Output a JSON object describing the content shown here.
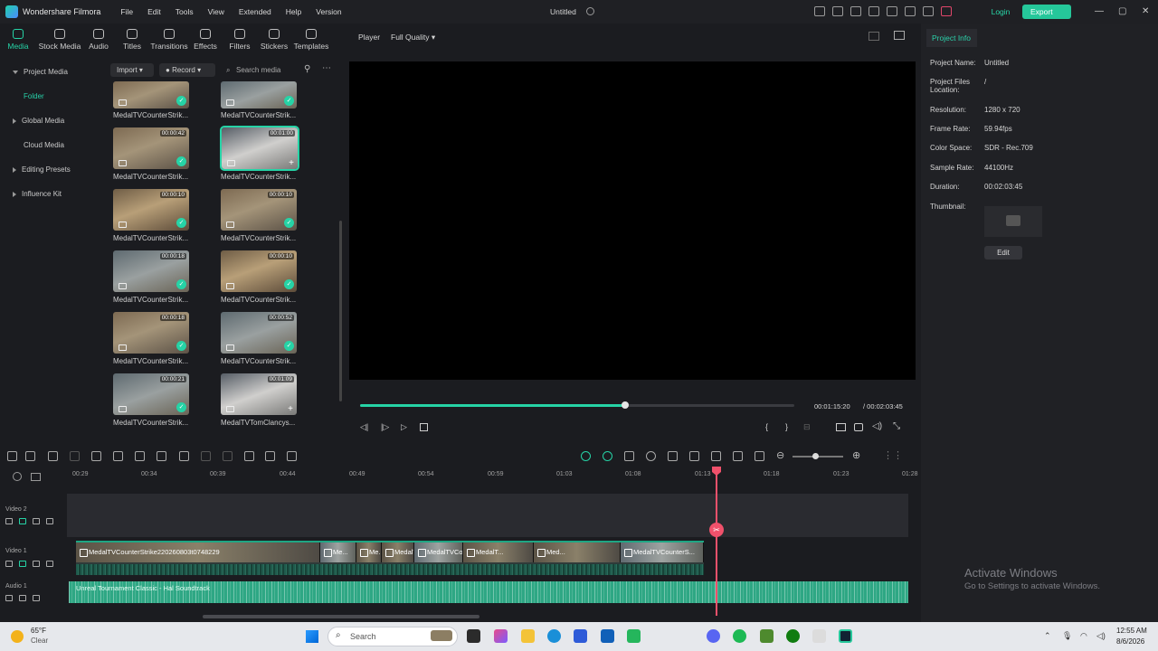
{
  "app": {
    "name": "Wondershare Filmora",
    "menu": [
      "File",
      "Edit",
      "Tools",
      "View",
      "Extended",
      "Help",
      "Version"
    ],
    "project_title": "Untitled",
    "login": "Login",
    "export": "Export"
  },
  "toolbar": [
    "Media",
    "Stock Media",
    "Audio",
    "Titles",
    "Transitions",
    "Effects",
    "Filters",
    "Stickers",
    "Templates"
  ],
  "sidebar": [
    {
      "label": "Project Media"
    },
    {
      "label": "Folder"
    },
    {
      "label": "Global Media"
    },
    {
      "label": "Cloud Media"
    },
    {
      "label": "Editing Presets"
    },
    {
      "label": "Influence Kit"
    }
  ],
  "media_tools": {
    "import": "Import",
    "record": "Record",
    "search_placeholder": "Search media"
  },
  "media": [
    {
      "caption": "MedalTVCounterStrik...",
      "duration": ""
    },
    {
      "caption": "MedalTVCounterStrik...",
      "duration": ""
    },
    {
      "caption": "MedalTVCounterStrik...",
      "duration": "00:00:42"
    },
    {
      "caption": "MedalTVCounterStrik...",
      "duration": "00:01:00"
    },
    {
      "caption": "MedalTVCounterStrik...",
      "duration": "00:00:10"
    },
    {
      "caption": "MedalTVCounterStrik...",
      "duration": "00:00:10"
    },
    {
      "caption": "MedalTVCounterStrik...",
      "duration": "00:00:18"
    },
    {
      "caption": "MedalTVCounterStrik...",
      "duration": "00:00:10"
    },
    {
      "caption": "MedalTVCounterStrik...",
      "duration": "00:00:18"
    },
    {
      "caption": "MedalTVCounterStrik...",
      "duration": "00:00:52"
    },
    {
      "caption": "MedalTVCounterStrik...",
      "duration": "00:00:21"
    },
    {
      "caption": "MedalTVTomClancys...",
      "duration": "00:01:09"
    }
  ],
  "player": {
    "label": "Player",
    "quality": "Full Quality",
    "current_time": "00:01:15:20",
    "total_time": "/ 00:02:03:45",
    "progress": 0.61
  },
  "info": {
    "tab": "Project Info",
    "rows": [
      {
        "label": "Project Name:",
        "value": "Untitled"
      },
      {
        "label": "Project Files Location:",
        "value": "/"
      },
      {
        "label": "Resolution:",
        "value": "1280 x 720"
      },
      {
        "label": "Frame Rate:",
        "value": "59.94fps"
      },
      {
        "label": "Color Space:",
        "value": "SDR - Rec.709"
      },
      {
        "label": "Sample Rate:",
        "value": "44100Hz"
      },
      {
        "label": "Duration:",
        "value": "00:02:03:45"
      },
      {
        "label": "Thumbnail:",
        "value": ""
      }
    ],
    "edit": "Edit"
  },
  "watermark": {
    "title": "Activate Windows",
    "sub": "Go to Settings to activate Windows."
  },
  "ruler": [
    "00:29",
    "00:34",
    "00:39",
    "00:44",
    "00:49",
    "00:54",
    "00:59",
    "01:03",
    "01:08",
    "01:13",
    "01:18",
    "01:23",
    "01:28"
  ],
  "tracks": {
    "video2": "Video 2",
    "video1": "Video 1",
    "audio1": "Audio 1",
    "clips": [
      "MedalTVCounterStrike220260803t0748229",
      "Me...",
      "Me...",
      "MedalT...",
      "MedalTVCoun...",
      "MedalT...",
      "Med...",
      "MedalTVCounterS..."
    ],
    "audio_name": "Unreal Tournament Classic - Hal Soundtrack"
  },
  "taskbar": {
    "temp": "65°F",
    "weather": "Clear",
    "search": "Search",
    "time": "12:55 AM",
    "date": "8/6/2026"
  }
}
